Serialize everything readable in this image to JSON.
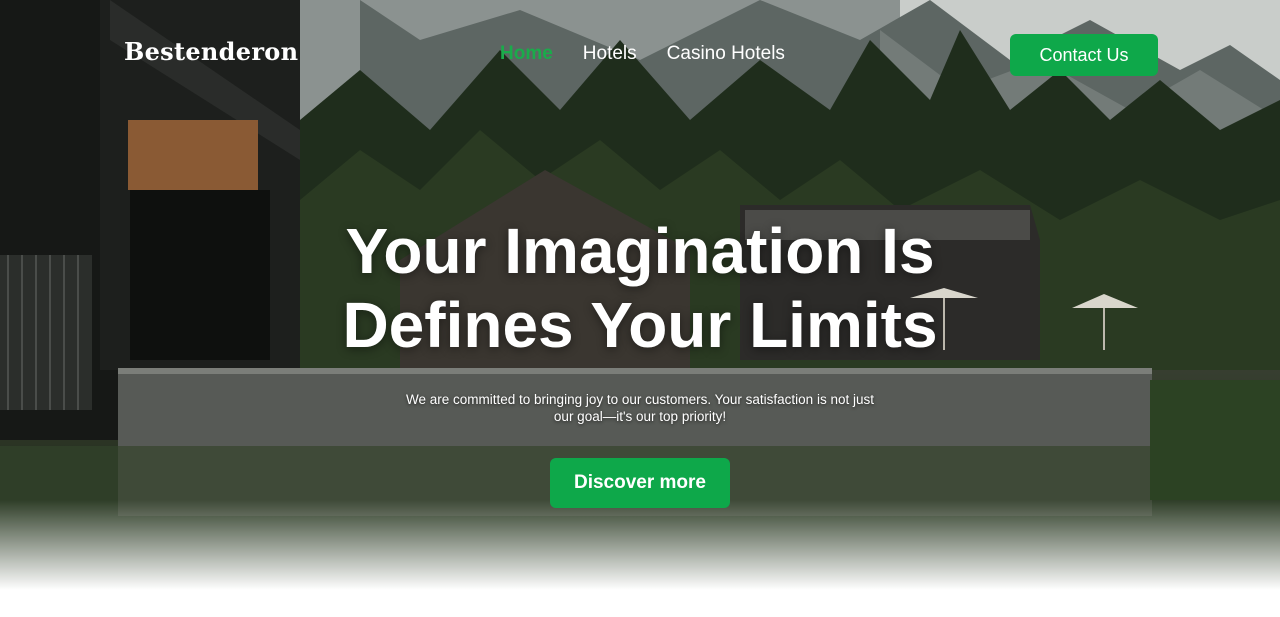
{
  "brand": {
    "logo_text": "Bestenderon"
  },
  "nav": {
    "links": [
      {
        "label": "Home",
        "active": true
      },
      {
        "label": "Hotels",
        "active": false
      },
      {
        "label": "Casino Hotels",
        "active": false
      }
    ],
    "contact_label": "Contact Us"
  },
  "hero": {
    "headline_line1": "Your Imagination Is",
    "headline_line2": "Defines Your Limits",
    "subtext": "We are committed to bringing joy to our customers. Your satisfaction is not just our goal—it's our top priority!",
    "cta_label": "Discover more",
    "background": "mountain-lake-hotel-photo"
  },
  "colors": {
    "accent": "#0ea84a",
    "active_link": "#1aab4b",
    "text": "#ffffff"
  }
}
